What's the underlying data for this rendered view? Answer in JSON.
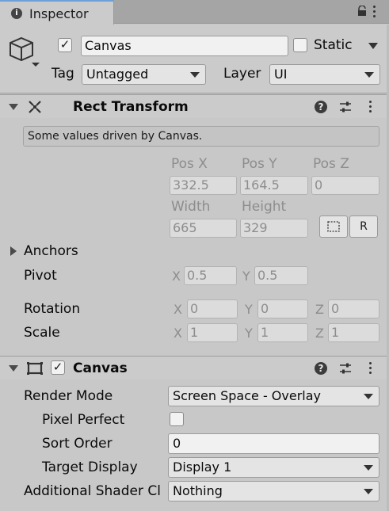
{
  "tab": {
    "title": "Inspector",
    "info_glyph": "i",
    "icons": [
      "info-icon",
      "lock-icon",
      "kebab-menu-icon"
    ]
  },
  "header": {
    "object_active": true,
    "object_name": "Canvas",
    "static_label": "Static",
    "static_checked": false,
    "tag_label": "Tag",
    "tag_value": "Untagged",
    "layer_label": "Layer",
    "layer_value": "UI"
  },
  "rect_transform": {
    "title": "Rect Transform",
    "info": "Some values driven by Canvas.",
    "pos_x_label": "Pos X",
    "pos_y_label": "Pos Y",
    "pos_z_label": "Pos Z",
    "pos_x": "332.5",
    "pos_y": "164.5",
    "pos_z": "0",
    "width_label": "Width",
    "height_label": "Height",
    "width": "665",
    "height": "329",
    "raw_edit_label": "R",
    "anchors_label": "Anchors",
    "pivot_label": "Pivot",
    "pivot_x": "0.5",
    "pivot_y": "0.5",
    "rotation_label": "Rotation",
    "rot_x": "0",
    "rot_y": "0",
    "rot_z": "0",
    "scale_label": "Scale",
    "scale_x": "1",
    "scale_y": "1",
    "scale_z": "1",
    "axis_x": "X",
    "axis_y": "Y",
    "axis_z": "Z"
  },
  "canvas": {
    "title": "Canvas",
    "enabled": true,
    "render_mode_label": "Render Mode",
    "render_mode_value": "Screen Space - Overlay",
    "pixel_perfect_label": "Pixel Perfect",
    "pixel_perfect_checked": false,
    "sort_order_label": "Sort Order",
    "sort_order_value": "0",
    "target_display_label": "Target Display",
    "target_display_value": "Display 1",
    "shader_channels_label": "Additional Shader Cl",
    "shader_channels_value": "Nothing"
  },
  "colors": {
    "accent": "#6f9fd8",
    "panel": "#c8c8c8",
    "header": "#cbcbcb",
    "tabbar": "#a5a5a5"
  }
}
